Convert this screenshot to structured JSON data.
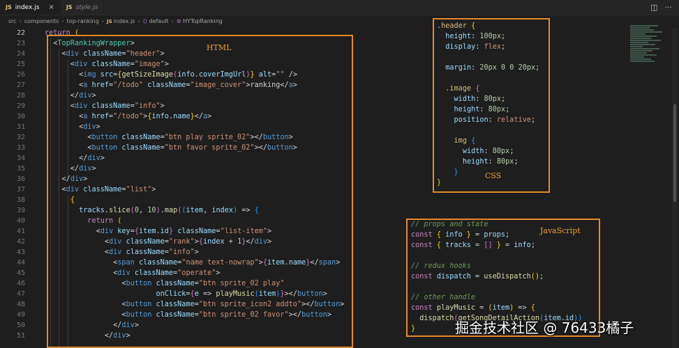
{
  "tabs": [
    {
      "badge": "JS",
      "label": "index.js",
      "close": "×"
    },
    {
      "badge": "JS",
      "label": "style.js"
    }
  ],
  "breadcrumb": {
    "parts": [
      "src",
      "components",
      "top-ranking"
    ],
    "file_badge": "JS",
    "file": "index.js",
    "export_sym": "⟨⟩",
    "export_label": "default",
    "component_sym": "⊚",
    "component_label": "HYTopRanking",
    "separator": "›"
  },
  "toolbar": {
    "split_icon": "◫",
    "more_icon": "···"
  },
  "line_numbers": [
    "22",
    "23",
    "24",
    "25",
    "26",
    "27",
    "28",
    "29",
    "30",
    "31",
    "32",
    "33",
    "34",
    "35",
    "36",
    "37",
    "38",
    "39",
    "40",
    "41",
    "42",
    "43",
    "44",
    "45",
    "46",
    "47",
    "48",
    "49",
    "50",
    "51"
  ],
  "annotations": {
    "html_label": "HTML",
    "css_label": "CSS",
    "js_label": "JavaScript"
  },
  "code_lines": [
    [
      [
        "kw",
        "return "
      ],
      [
        "br1",
        "("
      ]
    ],
    [
      [
        "pl",
        "  <"
      ],
      [
        "tag",
        "TopRankingWrapper"
      ],
      [
        "pl",
        ">"
      ]
    ],
    [
      [
        "pl",
        "    <"
      ],
      [
        "htag",
        "div"
      ],
      [
        "attr",
        " className"
      ],
      [
        "pl",
        "="
      ],
      [
        "str",
        "\"header\""
      ],
      [
        "pl",
        ">"
      ]
    ],
    [
      [
        "pl",
        "      <"
      ],
      [
        "htag",
        "div"
      ],
      [
        "attr",
        " className"
      ],
      [
        "pl",
        "="
      ],
      [
        "str",
        "\"image\""
      ],
      [
        "pl",
        ">"
      ]
    ],
    [
      [
        "pl",
        "        <"
      ],
      [
        "htag",
        "img"
      ],
      [
        "attr",
        " src"
      ],
      [
        "pl",
        "="
      ],
      [
        "br1",
        "{"
      ],
      [
        "fn",
        "getSizeImage"
      ],
      [
        "br2",
        "("
      ],
      [
        "var",
        "info"
      ],
      [
        "pl",
        "."
      ],
      [
        "var",
        "coverImgUrl"
      ],
      [
        "br2",
        ")"
      ],
      [
        "br1",
        "}"
      ],
      [
        "attr",
        " alt"
      ],
      [
        "pl",
        "="
      ],
      [
        "str",
        "\"\""
      ],
      [
        "pl",
        " />"
      ]
    ],
    [
      [
        "pl",
        "        <"
      ],
      [
        "htag",
        "a"
      ],
      [
        "attr",
        " href"
      ],
      [
        "pl",
        "="
      ],
      [
        "str",
        "\"/todo\""
      ],
      [
        "attr",
        " className"
      ],
      [
        "pl",
        "="
      ],
      [
        "str",
        "\"image_cover\""
      ],
      [
        "pl",
        ">ranking</"
      ],
      [
        "htag",
        "a"
      ],
      [
        "pl",
        ">"
      ]
    ],
    [
      [
        "pl",
        "      </"
      ],
      [
        "htag",
        "div"
      ],
      [
        "pl",
        ">"
      ]
    ],
    [
      [
        "pl",
        "      <"
      ],
      [
        "htag",
        "div"
      ],
      [
        "attr",
        " className"
      ],
      [
        "pl",
        "="
      ],
      [
        "str",
        "\"info\""
      ],
      [
        "pl",
        ">"
      ]
    ],
    [
      [
        "pl",
        "        <"
      ],
      [
        "htag",
        "a"
      ],
      [
        "attr",
        " href"
      ],
      [
        "pl",
        "="
      ],
      [
        "str",
        "\"/todo\""
      ],
      [
        "pl",
        ">"
      ],
      [
        "br1",
        "{"
      ],
      [
        "var",
        "info"
      ],
      [
        "pl",
        "."
      ],
      [
        "var",
        "name"
      ],
      [
        "br1",
        "}"
      ],
      [
        "pl",
        "</"
      ],
      [
        "htag",
        "a"
      ],
      [
        "pl",
        ">"
      ]
    ],
    [
      [
        "pl",
        "        <"
      ],
      [
        "htag",
        "div"
      ],
      [
        "pl",
        ">"
      ]
    ],
    [
      [
        "pl",
        "          <"
      ],
      [
        "htag",
        "button"
      ],
      [
        "attr",
        " className"
      ],
      [
        "pl",
        "="
      ],
      [
        "str",
        "\"btn play sprite_02\""
      ],
      [
        "pl",
        "></"
      ],
      [
        "htag",
        "button"
      ],
      [
        "pl",
        ">"
      ]
    ],
    [
      [
        "pl",
        "          <"
      ],
      [
        "htag",
        "button"
      ],
      [
        "attr",
        " className"
      ],
      [
        "pl",
        "="
      ],
      [
        "str",
        "\"btn favor sprite_02\""
      ],
      [
        "pl",
        "></"
      ],
      [
        "htag",
        "button"
      ],
      [
        "pl",
        ">"
      ]
    ],
    [
      [
        "pl",
        "        </"
      ],
      [
        "htag",
        "div"
      ],
      [
        "pl",
        ">"
      ]
    ],
    [
      [
        "pl",
        "      </"
      ],
      [
        "htag",
        "div"
      ],
      [
        "pl",
        ">"
      ]
    ],
    [
      [
        "pl",
        "    </"
      ],
      [
        "htag",
        "div"
      ],
      [
        "pl",
        ">"
      ]
    ],
    [
      [
        "pl",
        "    <"
      ],
      [
        "htag",
        "div"
      ],
      [
        "attr",
        " className"
      ],
      [
        "pl",
        "="
      ],
      [
        "str",
        "\"list\""
      ],
      [
        "pl",
        ">"
      ]
    ],
    [
      [
        "pl",
        "      "
      ],
      [
        "br1",
        "{"
      ]
    ],
    [
      [
        "pl",
        "        "
      ],
      [
        "var",
        "tracks"
      ],
      [
        "pl",
        "."
      ],
      [
        "fn",
        "slice"
      ],
      [
        "br2",
        "("
      ],
      [
        "num",
        "0"
      ],
      [
        "pl",
        ", "
      ],
      [
        "num",
        "10"
      ],
      [
        "br2",
        ")"
      ],
      [
        "pl",
        "."
      ],
      [
        "fn",
        "map"
      ],
      [
        "br2",
        "("
      ],
      [
        "br3",
        "("
      ],
      [
        "var",
        "item"
      ],
      [
        "pl",
        ", "
      ],
      [
        "var",
        "index"
      ],
      [
        "br3",
        ")"
      ],
      [
        "pl",
        " => "
      ],
      [
        "br3",
        "{"
      ]
    ],
    [
      [
        "pl",
        "          "
      ],
      [
        "kw",
        "return"
      ],
      [
        "pl",
        " "
      ],
      [
        "br1",
        "("
      ]
    ],
    [
      [
        "pl",
        "            <"
      ],
      [
        "htag",
        "div"
      ],
      [
        "attr",
        " key"
      ],
      [
        "pl",
        "="
      ],
      [
        "br2",
        "{"
      ],
      [
        "var",
        "item"
      ],
      [
        "pl",
        "."
      ],
      [
        "var",
        "id"
      ],
      [
        "br2",
        "}"
      ],
      [
        "attr",
        " className"
      ],
      [
        "pl",
        "="
      ],
      [
        "str",
        "\"list-item\""
      ],
      [
        "pl",
        ">"
      ]
    ],
    [
      [
        "pl",
        "              <"
      ],
      [
        "htag",
        "div"
      ],
      [
        "attr",
        " className"
      ],
      [
        "pl",
        "="
      ],
      [
        "str",
        "\"rank\""
      ],
      [
        "pl",
        ">"
      ],
      [
        "br2",
        "{"
      ],
      [
        "var",
        "index"
      ],
      [
        "pl",
        " + "
      ],
      [
        "num",
        "1"
      ],
      [
        "br2",
        "}"
      ],
      [
        "pl",
        "</"
      ],
      [
        "htag",
        "div"
      ],
      [
        "pl",
        ">"
      ]
    ],
    [
      [
        "pl",
        "              <"
      ],
      [
        "htag",
        "div"
      ],
      [
        "attr",
        " className"
      ],
      [
        "pl",
        "="
      ],
      [
        "str",
        "\"info\""
      ],
      [
        "pl",
        ">"
      ]
    ],
    [
      [
        "pl",
        "                <"
      ],
      [
        "htag",
        "span"
      ],
      [
        "attr",
        " className"
      ],
      [
        "pl",
        "="
      ],
      [
        "str",
        "\"name text-nowrap\""
      ],
      [
        "pl",
        ">"
      ],
      [
        "br2",
        "{"
      ],
      [
        "var",
        "item"
      ],
      [
        "pl",
        "."
      ],
      [
        "var",
        "name"
      ],
      [
        "br2",
        "}"
      ],
      [
        "pl",
        "</"
      ],
      [
        "htag",
        "span"
      ],
      [
        "pl",
        ">"
      ]
    ],
    [
      [
        "pl",
        "                <"
      ],
      [
        "htag",
        "div"
      ],
      [
        "attr",
        " className"
      ],
      [
        "pl",
        "="
      ],
      [
        "str",
        "\"operate\""
      ],
      [
        "pl",
        ">"
      ]
    ],
    [
      [
        "pl",
        "                  <"
      ],
      [
        "htag",
        "button"
      ],
      [
        "attr",
        " className"
      ],
      [
        "pl",
        "="
      ],
      [
        "str",
        "\"btn sprite_02 play\""
      ]
    ],
    [
      [
        "pl",
        "                          "
      ],
      [
        "attr",
        "onClick"
      ],
      [
        "pl",
        "="
      ],
      [
        "br2",
        "{"
      ],
      [
        "var",
        "e"
      ],
      [
        "pl",
        " => "
      ],
      [
        "fn",
        "playMusic"
      ],
      [
        "br3",
        "("
      ],
      [
        "var",
        "item"
      ],
      [
        "br3",
        ")"
      ],
      [
        "br2",
        "}"
      ],
      [
        "pl",
        "></"
      ],
      [
        "htag",
        "button"
      ],
      [
        "pl",
        ">"
      ]
    ],
    [
      [
        "pl",
        "                  <"
      ],
      [
        "htag",
        "button"
      ],
      [
        "attr",
        " className"
      ],
      [
        "pl",
        "="
      ],
      [
        "str",
        "\"btn sprite_icon2 addto\""
      ],
      [
        "pl",
        "></"
      ],
      [
        "htag",
        "button"
      ],
      [
        "pl",
        ">"
      ]
    ],
    [
      [
        "pl",
        "                  <"
      ],
      [
        "htag",
        "button"
      ],
      [
        "attr",
        " className"
      ],
      [
        "pl",
        "="
      ],
      [
        "str",
        "\"btn sprite_02 favor\""
      ],
      [
        "pl",
        "></"
      ],
      [
        "htag",
        "button"
      ],
      [
        "pl",
        ">"
      ]
    ],
    [
      [
        "pl",
        "                </"
      ],
      [
        "htag",
        "div"
      ],
      [
        "pl",
        ">"
      ]
    ],
    [
      [
        "pl",
        "              </"
      ],
      [
        "htag",
        "div"
      ],
      [
        "pl",
        ">"
      ]
    ]
  ],
  "css_lines": [
    [
      [
        "css-sel",
        ".header"
      ],
      [
        "pl",
        " "
      ],
      [
        "br1",
        "{"
      ]
    ],
    [
      [
        "pl",
        "  "
      ],
      [
        "css-prop",
        "height"
      ],
      [
        "pl",
        ": "
      ],
      [
        "css-num",
        "100px"
      ],
      [
        "pl",
        ";"
      ]
    ],
    [
      [
        "pl",
        "  "
      ],
      [
        "css-prop",
        "display"
      ],
      [
        "pl",
        ": "
      ],
      [
        "css-val",
        "flex"
      ],
      [
        "pl",
        ";"
      ]
    ],
    [
      [
        "pl",
        ""
      ]
    ],
    [
      [
        "pl",
        "  "
      ],
      [
        "css-prop",
        "margin"
      ],
      [
        "pl",
        ": "
      ],
      [
        "css-num",
        "20px 0 0 20px"
      ],
      [
        "pl",
        ";"
      ]
    ],
    [
      [
        "pl",
        ""
      ]
    ],
    [
      [
        "pl",
        "  "
      ],
      [
        "css-sel",
        ".image"
      ],
      [
        "pl",
        " "
      ],
      [
        "br2",
        "{"
      ]
    ],
    [
      [
        "pl",
        "    "
      ],
      [
        "css-prop",
        "width"
      ],
      [
        "pl",
        ": "
      ],
      [
        "css-num",
        "80px"
      ],
      [
        "pl",
        ";"
      ]
    ],
    [
      [
        "pl",
        "    "
      ],
      [
        "css-prop",
        "height"
      ],
      [
        "pl",
        ": "
      ],
      [
        "css-num",
        "80px"
      ],
      [
        "pl",
        ";"
      ]
    ],
    [
      [
        "pl",
        "    "
      ],
      [
        "css-prop",
        "position"
      ],
      [
        "pl",
        ": "
      ],
      [
        "css-val",
        "relative"
      ],
      [
        "pl",
        ";"
      ]
    ],
    [
      [
        "pl",
        ""
      ]
    ],
    [
      [
        "pl",
        "    "
      ],
      [
        "css-sel",
        "img"
      ],
      [
        "pl",
        " "
      ],
      [
        "br3",
        "{"
      ]
    ],
    [
      [
        "pl",
        "      "
      ],
      [
        "css-prop",
        "width"
      ],
      [
        "pl",
        ": "
      ],
      [
        "css-num",
        "80px"
      ],
      [
        "pl",
        ";"
      ]
    ],
    [
      [
        "pl",
        "      "
      ],
      [
        "css-prop",
        "height"
      ],
      [
        "pl",
        ": "
      ],
      [
        "css-num",
        "80px"
      ],
      [
        "pl",
        ";"
      ]
    ],
    [
      [
        "pl",
        "    "
      ],
      [
        "br3",
        "}"
      ]
    ],
    [
      [
        "br1",
        "}"
      ]
    ]
  ],
  "js_lines": [
    [
      [
        "cm",
        "// props and state"
      ]
    ],
    [
      [
        "kw",
        "const"
      ],
      [
        "pl",
        " "
      ],
      [
        "br1",
        "{"
      ],
      [
        "pl",
        " "
      ],
      [
        "var",
        "info"
      ],
      [
        "pl",
        " "
      ],
      [
        "br1",
        "}"
      ],
      [
        "pl",
        " = "
      ],
      [
        "var",
        "props"
      ],
      [
        "pl",
        ";"
      ]
    ],
    [
      [
        "kw",
        "const"
      ],
      [
        "pl",
        " "
      ],
      [
        "br1",
        "{"
      ],
      [
        "pl",
        " "
      ],
      [
        "var",
        "tracks"
      ],
      [
        "pl",
        " = "
      ],
      [
        "br2",
        "[]"
      ],
      [
        "pl",
        " "
      ],
      [
        "br1",
        "}"
      ],
      [
        "pl",
        " = "
      ],
      [
        "var",
        "info"
      ],
      [
        "pl",
        ";"
      ]
    ],
    [
      [
        "pl",
        ""
      ]
    ],
    [
      [
        "cm",
        "// redux hooks"
      ]
    ],
    [
      [
        "kw",
        "const"
      ],
      [
        "pl",
        " "
      ],
      [
        "var",
        "dispatch"
      ],
      [
        "pl",
        " = "
      ],
      [
        "fn",
        "useDispatch"
      ],
      [
        "br1",
        "()"
      ],
      [
        "pl",
        ";"
      ]
    ],
    [
      [
        "pl",
        ""
      ]
    ],
    [
      [
        "cm",
        "// other handle"
      ]
    ],
    [
      [
        "kw",
        "const"
      ],
      [
        "pl",
        " "
      ],
      [
        "fn",
        "playMusic"
      ],
      [
        "pl",
        " = "
      ],
      [
        "br1",
        "("
      ],
      [
        "var",
        "item"
      ],
      [
        "br1",
        ")"
      ],
      [
        "pl",
        " => "
      ],
      [
        "br1",
        "{"
      ]
    ],
    [
      [
        "pl",
        "  "
      ],
      [
        "fn",
        "dispatch"
      ],
      [
        "br2",
        "("
      ],
      [
        "fn",
        "getSongDetailAction"
      ],
      [
        "br3",
        "("
      ],
      [
        "var",
        "item"
      ],
      [
        "pl",
        "."
      ],
      [
        "var",
        "id"
      ],
      [
        "br3",
        "))"
      ]
    ],
    [
      [
        "br1",
        "}"
      ]
    ]
  ],
  "watermark": "掘金技术社区 @ 76433橘子"
}
